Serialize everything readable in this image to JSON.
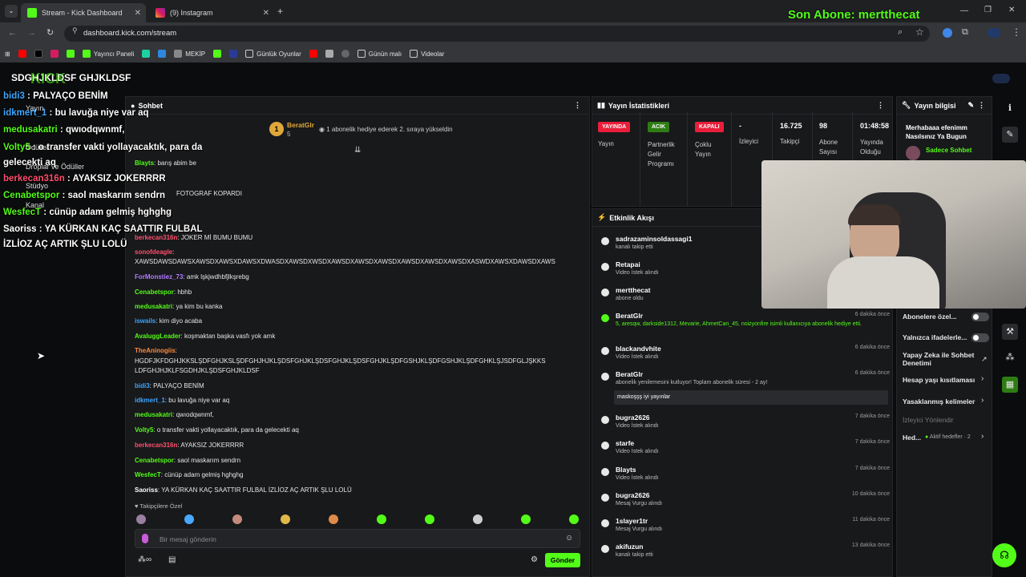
{
  "browser": {
    "tabs": [
      {
        "label": "Stream - Kick Dashboard",
        "active": true
      },
      {
        "label": "(9) Instagram",
        "active": false
      }
    ],
    "url": "dashboard.kick.com/stream",
    "bookmarks": [
      "Yayıncı Paneli",
      "MEKİP",
      "Günlük Oyunlar",
      "Günün malı",
      "Videolar"
    ],
    "son_abone": "Son Abone: mertthecat"
  },
  "overlay_chat": [
    {
      "user": "bidi3",
      "text": " : PALYAÇO BENİM",
      "color": "#3ea6ff"
    },
    {
      "user": "idkmert_1",
      "text": " : bu lavuğa niye var aq",
      "color": "#3ea6ff"
    },
    {
      "user": "medusakatri",
      "text": " : qwıodqwnmf,",
      "color": "#53fc18"
    },
    {
      "user": "Volty5",
      "text": " : o transfer vakti yollayacaktık, para da gelecekti aq",
      "color": "#53fc18"
    },
    {
      "user": "berkecan316n",
      "text": " : AYAKSIZ JOKERRRR",
      "color": "#ff4f6e"
    },
    {
      "user": "Cenabetspor",
      "text": " : saol maskarım sendrn",
      "color": "#53fc18"
    },
    {
      "user": "WesfecT",
      "text": " : cünüp adam gelmiş hghghg",
      "color": "#53fc18"
    },
    {
      "user": "Saoriss",
      "text": " : YA KÜRKAN KAÇ SAATTIR FULBAL İZLİOZ AÇ ARTIK ŞLU LOLÜ",
      "color": "#ffffff"
    }
  ],
  "overlay_partial": [
    "SDGHJKLDSF GHJKLDSF",
    "Yayın",
    "Ödüller",
    "Droplar ve Ödüller",
    "Stüdyo",
    "Kanal"
  ],
  "chat": {
    "title": "Sohbet",
    "pinned_user": "BeratGlr",
    "pinned_count": "5",
    "pinned_text": "1 abonelik hediye ederek 2. sıraya yükseldin",
    "messages": [
      {
        "user": "Blayts",
        "text": ": barış abim be",
        "color": "#53fc18"
      },
      {
        "user": "",
        "text": "FOTOGRAF KOPARDI",
        "color": "#53fc18"
      },
      {
        "user": "berkecan316n",
        "text": ": JOKER Mİ BUMU BUMU",
        "color": "#ff4f6e"
      },
      {
        "user": "sonofdeagle",
        "text": ":",
        "color": "#ff4f6e"
      },
      {
        "user": "",
        "text": "XAWSDAWSDAWSXAWSDXAWSXDAWSXDWASDXAWSDXWSDXAWSDXAWSDXAWSDXAWSDXAWSDXAWSDXASWDXAWSXDAWSDXAWS",
        "color": ""
      },
      {
        "user": "ForMonstiez_73",
        "text": ": amk lşkjwdhbfjlkşrebg",
        "color": "#b07bff"
      },
      {
        "user": "Cenabetspor",
        "text": ": hbhb",
        "color": "#53fc18"
      },
      {
        "user": "medusakatri",
        "text": ": ya kim bu kanka",
        "color": "#53fc18"
      },
      {
        "user": "iswails",
        "text": ": kim diyo acaba",
        "color": "#3ea6ff"
      },
      {
        "user": "AvaluggLeader",
        "text": ": koşmaktan başka vasfı yok amk",
        "color": "#53fc18"
      },
      {
        "user": "TheAninogiis",
        "text": ":",
        "color": "#ff8a3d"
      },
      {
        "user": "",
        "text": "HGDFJKFDGHJKKSLŞDFGHJKSLŞDFGHJHJKLŞDSFGHJKLŞDSFGHJKLŞDSFGHJKLŞDFGSHJKLŞDFGSHJKLŞDFGHKLŞJSDFGLJŞKKS",
        "color": ""
      },
      {
        "user": "",
        "text": "LDFGHJHJKLFSGDHJKLŞDSFGHJKLDSF",
        "color": ""
      },
      {
        "user": "bidi3",
        "text": ": PALYAÇO BENİM",
        "color": "#3ea6ff"
      },
      {
        "user": "idkmert_1",
        "text": ": bu lavuğa niye var aq",
        "color": "#3ea6ff"
      },
      {
        "user": "medusakatri",
        "text": ": qwıodqwnmf,",
        "color": "#53fc18"
      },
      {
        "user": "Volty5",
        "text": ": o transfer vakti yollayacaktık, para da gelecekti aq",
        "color": "#53fc18"
      },
      {
        "user": "berkecan316n",
        "text": ": AYAKSIZ JOKERRRR",
        "color": "#ff4f6e"
      },
      {
        "user": "Cenabetspor",
        "text": ": saol maskarım sendrn",
        "color": "#53fc18"
      },
      {
        "user": "WesfecT",
        "text": ": cünüp adam gelmiş hghghg",
        "color": "#53fc18"
      },
      {
        "user": "Saoriss",
        "text": ": YA KÜRKAN KAÇ SAATTIR FULBAL İZLİOZ AÇ ARTIK ŞLU LOLÜ",
        "color": "#ffffff"
      }
    ],
    "follower_label": "Takipçilere Özel",
    "input_placeholder": "Bir mesaj gönderin",
    "send_label": "Gönder"
  },
  "stats": {
    "title": "Yayın İstatistikleri",
    "status": [
      {
        "badge": "YAYINDA",
        "label": "Yayın",
        "color": "#e91e3a"
      },
      {
        "badge": "ACIK",
        "label": "Partnerlik Gelir Programı",
        "color": "#3a9a1a"
      },
      {
        "badge": "KAPALI",
        "label": "Çoklu Yayın",
        "color": "#e91e3a"
      }
    ],
    "numbers": [
      {
        "value": "-",
        "label": "İzleyici"
      },
      {
        "value": "16.725",
        "label": "Takipçi"
      },
      {
        "value": "98",
        "label": "Abone Sayısı"
      },
      {
        "value": "01:48:58",
        "label": "Yayında Olduğu"
      }
    ]
  },
  "activity": {
    "title": "Etkinlik Akışı",
    "items": [
      {
        "name": "sadrazaminsoldassagi1",
        "sub": "kanalı takip etti",
        "time": ""
      },
      {
        "name": "Retapai",
        "sub": "Video İstek alındı",
        "time": ""
      },
      {
        "name": "mertthecat",
        "sub": "abone oldu",
        "time": ""
      },
      {
        "name": "BeratGlr",
        "sub": "5, aresqw, darkside1312, Mevarie, AhmetCan_45, noizyonfire isimli kullanıcıya abonelik hediye etti.",
        "time": "6 dakika önce"
      },
      {
        "name": "blackandvhite",
        "sub": "Video İstek alındı",
        "time": "6 dakika önce"
      },
      {
        "name": "BeratGlr",
        "sub": "abonelik yenilemesini kutluyor! Toplam abonelik süresi - 2 ay!",
        "time": "6 dakika önce"
      },
      {
        "name": "bugra2626",
        "sub": "Video İstek alındı",
        "time": "7 dakika önce"
      },
      {
        "name": "starfe",
        "sub": "Video İstek alındı",
        "time": "7 dakika önce"
      },
      {
        "name": "Blayts",
        "sub": "Video İstek alındı",
        "time": "7 dakika önce"
      },
      {
        "name": "bugra2626",
        "sub": "Mesaj Vurgu alındı",
        "time": "10 dakika önce"
      },
      {
        "name": "1slayer1tr",
        "sub": "Mesaj Vurgu alındı",
        "time": "11 dakika önce"
      },
      {
        "name": "akifuzun",
        "sub": "kanalı takip etti",
        "time": "13 dakika önce"
      }
    ],
    "resub_message": "maskoşşş iyi yayınlar"
  },
  "info": {
    "title": "Yayın bilgisi",
    "stream_title": "Merhabaaa efenimm Nasılsınız Ya Bugun",
    "chat_mode": "Sadece Sohbet",
    "rows": [
      "Abonelere özel...",
      "Yalnızca ifadelerle...",
      "Yapay Zeka ile Sohbet Denetimi",
      "Hesap yaşı kısıtlaması",
      "Yasaklanmış kelimeler",
      "İzleyici Yönlendir",
      "Hed..."
    ],
    "goals_label": "Aktif hedefler · 2"
  }
}
